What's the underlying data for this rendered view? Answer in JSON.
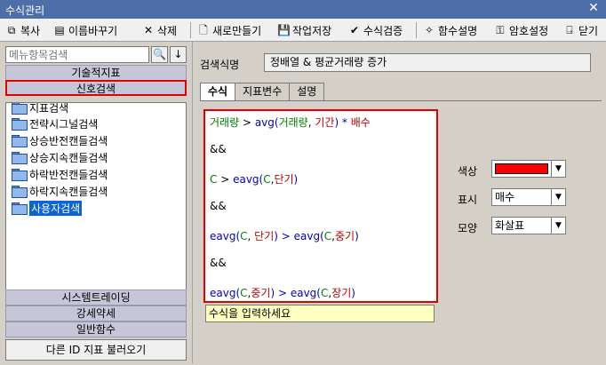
{
  "window": {
    "title": "수식관리",
    "close_glyph": "✕"
  },
  "toolbar": {
    "copy": "복사",
    "rename": "이름바꾸기",
    "delete": "삭제",
    "new": "새로만들기",
    "save": "작업저장",
    "verify": "수식검증",
    "func_help": "함수설명",
    "password": "암호설정",
    "close": "닫기"
  },
  "left_panel": {
    "search_placeholder": "메뉴항목검색",
    "search_btn": "🔍",
    "down_btn": "↓",
    "categories_top": [
      "기술적지표",
      "신호검색"
    ],
    "tree_items": [
      "지표검색",
      "전략시그널검색",
      "상승반전캔들검색",
      "상승지속캔들검색",
      "하락반전캔들검색",
      "하락지속캔들검색",
      "사용자검색"
    ],
    "selected_item": "사용자검색",
    "categories_bottom": [
      "시스템트레이딩",
      "강세약세",
      "일반함수"
    ],
    "load_other_id": "다른 ID 지표 불러오기"
  },
  "right_panel": {
    "formula_name_label": "검색식명",
    "formula_name": "정배열 & 평균거래량 증가",
    "tabs": [
      "수식",
      "지표변수",
      "설명"
    ],
    "active_tab": "수식",
    "code": [
      {
        "parts": [
          {
            "t": "거래량",
            "c": "green"
          },
          {
            "t": " > ",
            "c": "black"
          },
          {
            "t": "avg(",
            "c": "blue"
          },
          {
            "t": "거래량",
            "c": "green"
          },
          {
            "t": ", ",
            "c": "black"
          },
          {
            "t": "기간",
            "c": "red"
          },
          {
            "t": ") * ",
            "c": "blue"
          },
          {
            "t": "배수",
            "c": "red"
          }
        ]
      },
      {
        "parts": [
          {
            "t": "&&",
            "c": "black"
          }
        ]
      },
      {
        "parts": [
          {
            "t": "C",
            "c": "green"
          },
          {
            "t": " > ",
            "c": "black"
          },
          {
            "t": "eavg(",
            "c": "blue"
          },
          {
            "t": "C",
            "c": "green"
          },
          {
            "t": ",",
            "c": "black"
          },
          {
            "t": "단기",
            "c": "red"
          },
          {
            "t": ")",
            "c": "blue"
          }
        ]
      },
      {
        "parts": [
          {
            "t": "&&",
            "c": "black"
          }
        ]
      },
      {
        "parts": [
          {
            "t": "eavg(",
            "c": "blue"
          },
          {
            "t": "C",
            "c": "green"
          },
          {
            "t": ", ",
            "c": "black"
          },
          {
            "t": "단기",
            "c": "red"
          },
          {
            "t": ") > ",
            "c": "blue"
          },
          {
            "t": "eavg(",
            "c": "blue"
          },
          {
            "t": "C",
            "c": "green"
          },
          {
            "t": ",",
            "c": "black"
          },
          {
            "t": "중기",
            "c": "red"
          },
          {
            "t": ")",
            "c": "blue"
          }
        ]
      },
      {
        "parts": [
          {
            "t": "&&",
            "c": "black"
          }
        ]
      },
      {
        "parts": [
          {
            "t": "eavg(",
            "c": "blue"
          },
          {
            "t": "C",
            "c": "green"
          },
          {
            "t": ",",
            "c": "black"
          },
          {
            "t": "중기",
            "c": "red"
          },
          {
            "t": ") > ",
            "c": "blue"
          },
          {
            "t": "eavg(",
            "c": "blue"
          },
          {
            "t": "C",
            "c": "green"
          },
          {
            "t": ",",
            "c": "black"
          },
          {
            "t": "장기",
            "c": "red"
          },
          {
            "t": ")",
            "c": "blue"
          }
        ]
      }
    ],
    "hint": "수식을 입력하세요",
    "color_label": "색상",
    "color_value": "#ff0000",
    "display_label": "표시",
    "display_value": "매수",
    "shape_label": "모양",
    "shape_value": "화살표"
  }
}
